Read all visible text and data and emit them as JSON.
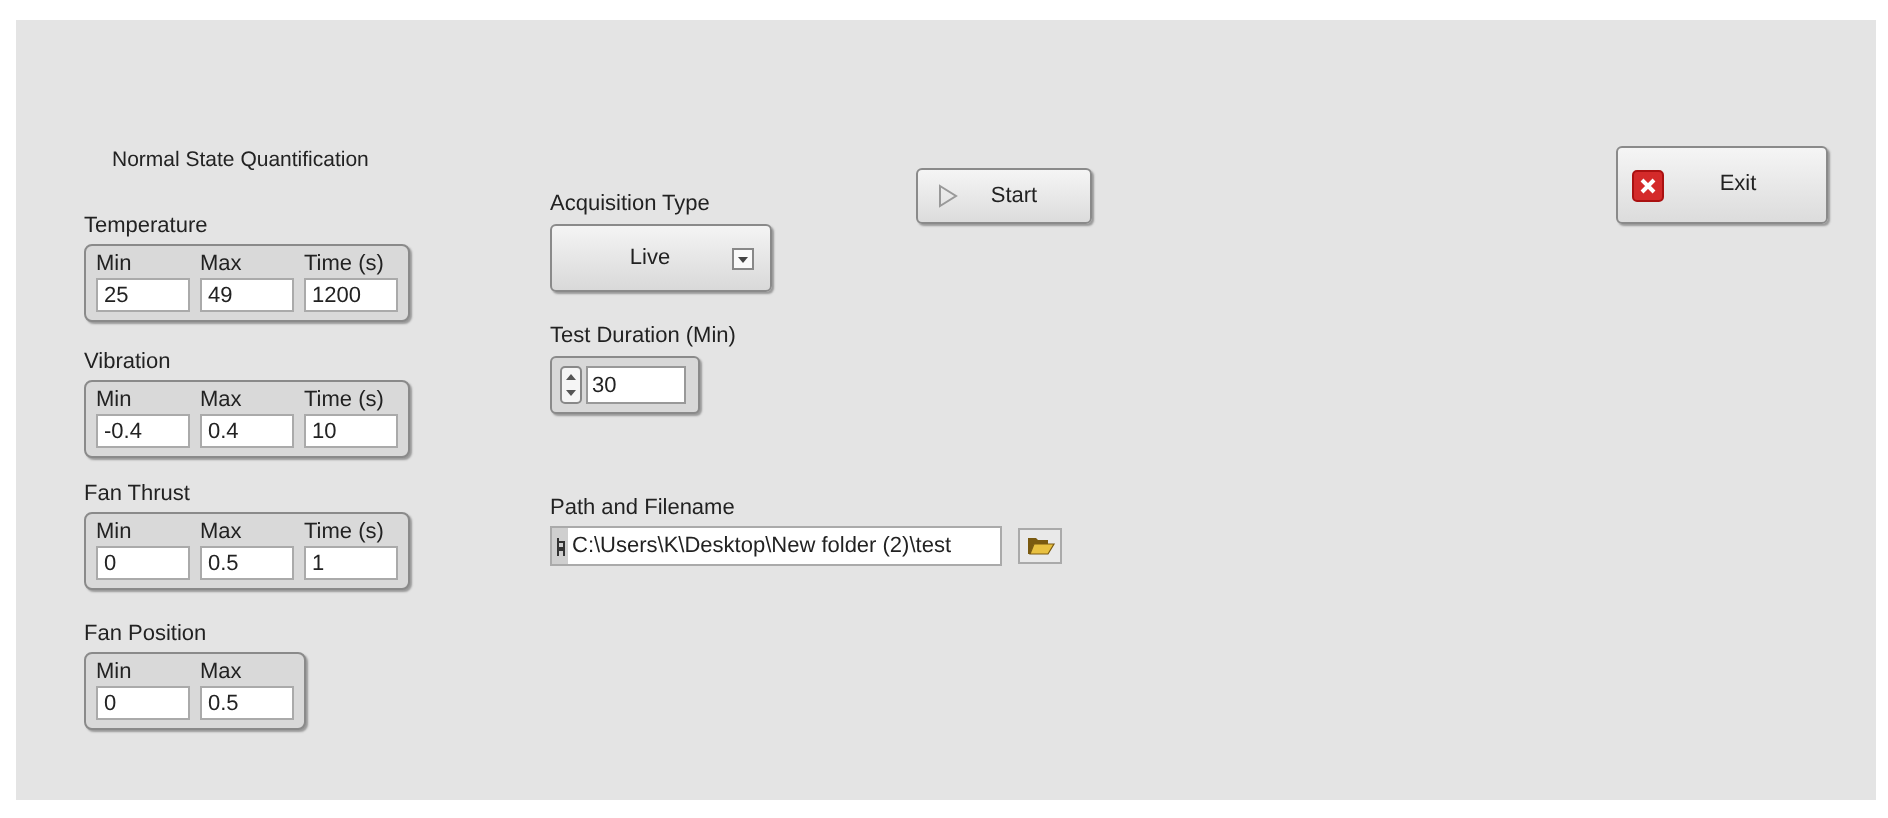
{
  "section_title": "Normal State Quantification",
  "clusters": [
    {
      "label": "Temperature",
      "columns": [
        "Min",
        "Max",
        "Time (s)"
      ],
      "values": [
        "25",
        "49",
        "1200"
      ]
    },
    {
      "label": "Vibration",
      "columns": [
        "Min",
        "Max",
        "Time (s)"
      ],
      "values": [
        "-0.4",
        "0.4",
        "10"
      ]
    },
    {
      "label": "Fan Thrust",
      "columns": [
        "Min",
        "Max",
        "Time (s)"
      ],
      "values": [
        "0",
        "0.5",
        "1"
      ]
    },
    {
      "label": "Fan Position",
      "columns": [
        "Min",
        "Max"
      ],
      "values": [
        "0",
        "0.5"
      ]
    }
  ],
  "acquisition_type": {
    "label": "Acquisition Type",
    "value": "Live"
  },
  "test_duration": {
    "label": "Test Duration (Min)",
    "value": "30"
  },
  "path": {
    "label": "Path and Filename",
    "value": "C:\\Users\\K\\Desktop\\New folder (2)\\test"
  },
  "start_button": "Start",
  "exit_button": "Exit"
}
